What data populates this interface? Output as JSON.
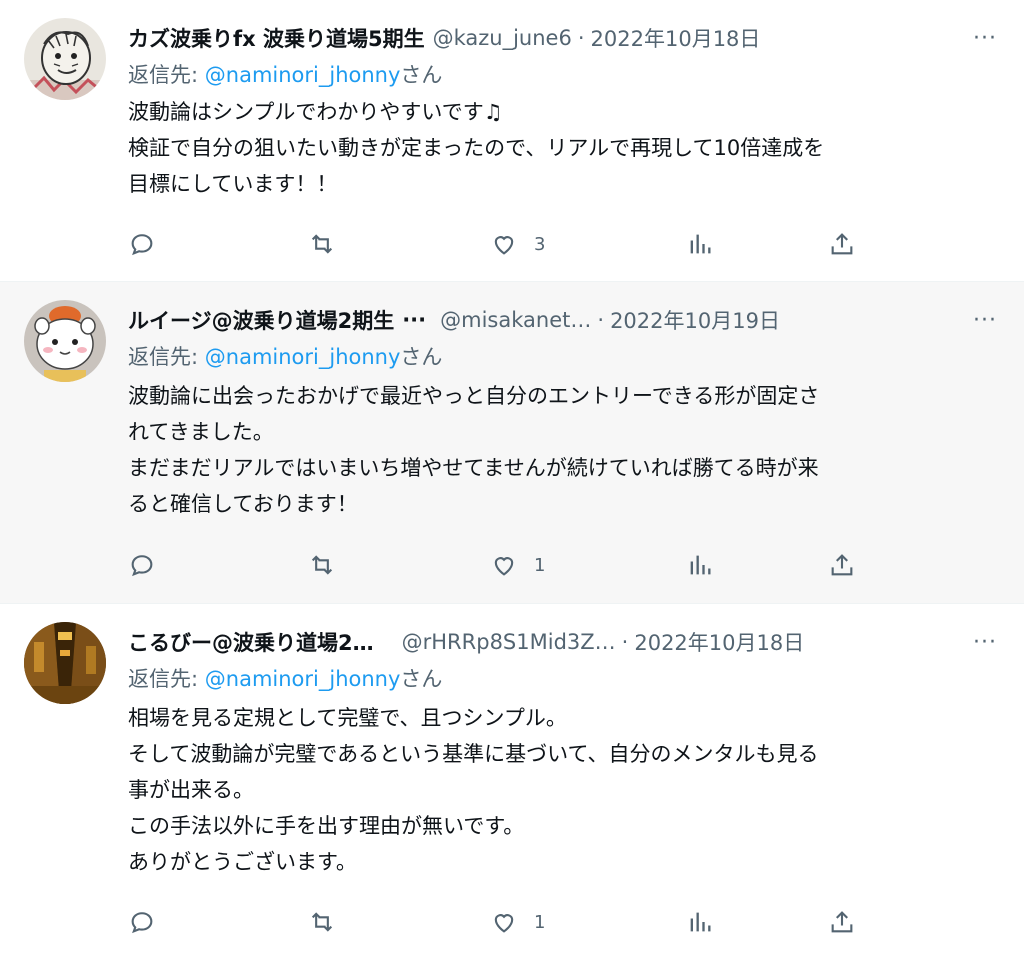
{
  "tweets": [
    {
      "name": "カズ波乗りfx 波乗り道場5期生",
      "name_truncated": false,
      "handle": "@kazu_june6",
      "date": "2022年10月18日",
      "reply_prefix": "返信先: ",
      "reply_to": "@naminori_jhonny",
      "reply_suffix": "さん",
      "lines": [
        "波動論はシンプルでわかりやすいです♫",
        "検証で自分の狙いたい動きが定まったので、リアルで再現して10倍達成を",
        "目標にしています！！"
      ],
      "like_count": "3"
    },
    {
      "name": "ルイージ@波乗り道場2期生",
      "name_truncated": true,
      "handle": "@misakanet…",
      "date": "2022年10月19日",
      "reply_prefix": "返信先: ",
      "reply_to": "@naminori_jhonny",
      "reply_suffix": "さん",
      "lines": [
        "波動論に出会ったおかげで最近やっと自分のエントリーできる形が固定さ",
        "れてきました。",
        "まだまだリアルではいまいち増やせてませんが続けていれば勝てる時が来",
        "ると確信しております！"
      ],
      "like_count": "1"
    },
    {
      "name": "こるびー@波乗り道場2…",
      "name_truncated": false,
      "handle": "@rHRRp8S1Mid3Z…",
      "date": "2022年10月18日",
      "reply_prefix": "返信先: ",
      "reply_to": "@naminori_jhonny",
      "reply_suffix": "さん",
      "lines": [
        "相場を見る定規として完璧で、且つシンプル。",
        "そして波動論が完璧であるという基準に基づいて、自分のメンタルも見る",
        "事が出来る。",
        "この手法以外に手を出す理由が無いです。",
        "ありがとうございます。"
      ],
      "like_count": "1"
    }
  ],
  "ui": {
    "more_glyph": "···",
    "date_separator": "·",
    "name_ellipsis": "···"
  },
  "icons": [
    "reply-icon",
    "retweet-icon",
    "like-icon",
    "views-icon",
    "share-icon",
    "more-icon"
  ],
  "colors": {
    "text": "#0f1419",
    "secondary": "#536471",
    "link": "#1d9bf0",
    "highlight_bg": "#f7f7f7"
  }
}
